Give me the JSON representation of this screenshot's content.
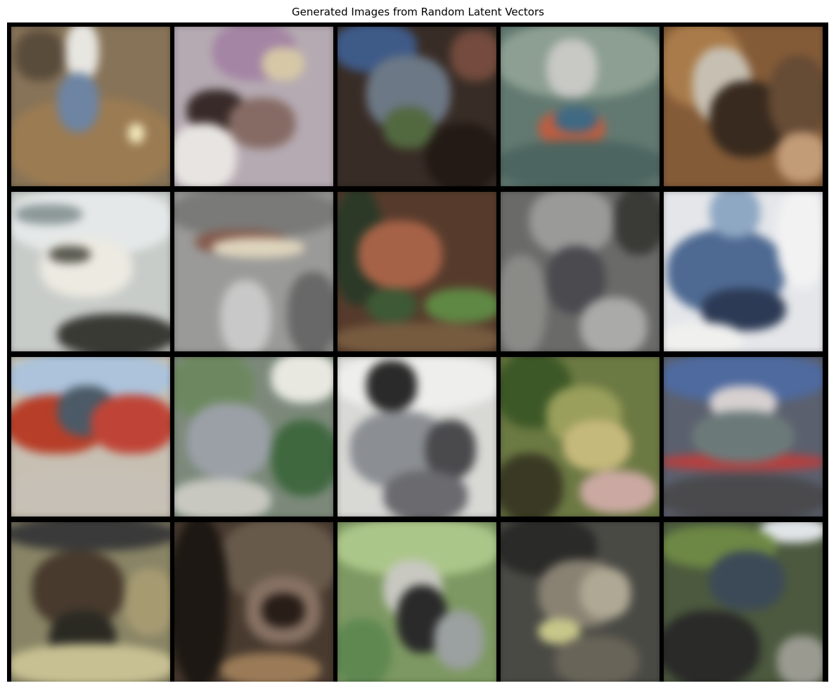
{
  "figure": {
    "title": "Generated Images from Random Latent Vectors"
  },
  "images": [
    {
      "id": "sample-1",
      "base": "#8a7352",
      "blobs": [
        [
          "#a07a4a",
          0.0,
          0.45,
          1.0,
          0.55
        ],
        [
          "#e8e6e0",
          0.35,
          0.0,
          0.2,
          0.35
        ],
        [
          "#6a84a8",
          0.3,
          0.3,
          0.25,
          0.35
        ],
        [
          "#f3e7b0",
          0.72,
          0.6,
          0.1,
          0.12
        ],
        [
          "#5c4c38",
          0.05,
          0.05,
          0.3,
          0.3
        ]
      ]
    },
    {
      "id": "sample-2",
      "base": "#b7a9b3",
      "blobs": [
        [
          "#a884a8",
          0.25,
          0.0,
          0.5,
          0.35
        ],
        [
          "#3a2a28",
          0.1,
          0.4,
          0.35,
          0.25
        ],
        [
          "#8a6a62",
          0.35,
          0.45,
          0.4,
          0.3
        ],
        [
          "#e8e4e0",
          0.0,
          0.6,
          0.4,
          0.4
        ],
        [
          "#d8c8a0",
          0.55,
          0.15,
          0.25,
          0.2
        ]
      ]
    },
    {
      "id": "sample-3",
      "base": "#3a2c24",
      "blobs": [
        [
          "#3a5a90",
          0.0,
          0.0,
          0.5,
          0.3
        ],
        [
          "#6a7888",
          0.2,
          0.2,
          0.5,
          0.45
        ],
        [
          "#4f6a3a",
          0.3,
          0.5,
          0.3,
          0.25
        ],
        [
          "#241a14",
          0.55,
          0.6,
          0.45,
          0.4
        ],
        [
          "#7a4a3a",
          0.7,
          0.05,
          0.3,
          0.3
        ]
      ]
    },
    {
      "id": "sample-4",
      "base": "#5e7a70",
      "blobs": [
        [
          "#8aa090",
          0.0,
          0.0,
          1.0,
          0.45
        ],
        [
          "#c8c8c4",
          0.3,
          0.1,
          0.3,
          0.35
        ],
        [
          "#c85a3a",
          0.25,
          0.52,
          0.4,
          0.22
        ],
        [
          "#3a6a8a",
          0.35,
          0.5,
          0.25,
          0.15
        ],
        [
          "#4a6660",
          0.0,
          0.7,
          1.0,
          0.3
        ]
      ]
    },
    {
      "id": "sample-5",
      "base": "#8a5a30",
      "blobs": [
        [
          "#b07a40",
          0.0,
          0.0,
          0.5,
          0.5
        ],
        [
          "#c8c0b0",
          0.2,
          0.15,
          0.35,
          0.45
        ],
        [
          "#3a2a1c",
          0.3,
          0.35,
          0.45,
          0.45
        ],
        [
          "#6a4a30",
          0.65,
          0.2,
          0.35,
          0.5
        ],
        [
          "#c89a70",
          0.7,
          0.65,
          0.3,
          0.3
        ]
      ]
    },
    {
      "id": "sample-6",
      "base": "#c8ccc8",
      "blobs": [
        [
          "#e4e8e8",
          0.0,
          0.0,
          1.0,
          0.4
        ],
        [
          "#8a9898",
          0.05,
          0.1,
          0.4,
          0.12
        ],
        [
          "#eceae0",
          0.2,
          0.3,
          0.55,
          0.35
        ],
        [
          "#5a5a50",
          0.25,
          0.35,
          0.25,
          0.1
        ],
        [
          "#3a3a34",
          0.3,
          0.75,
          0.7,
          0.25
        ]
      ]
    },
    {
      "id": "sample-7",
      "base": "#9a9a98",
      "blobs": [
        [
          "#7a7a78",
          0.0,
          0.0,
          1.0,
          0.3
        ],
        [
          "#8a5a4a",
          0.15,
          0.25,
          0.55,
          0.15
        ],
        [
          "#e0d4b8",
          0.25,
          0.3,
          0.55,
          0.12
        ],
        [
          "#c8c8c8",
          0.3,
          0.55,
          0.3,
          0.45
        ],
        [
          "#686868",
          0.7,
          0.5,
          0.3,
          0.5
        ]
      ]
    },
    {
      "id": "sample-8",
      "base": "#5a3a28",
      "blobs": [
        [
          "#2a3a24",
          0.0,
          0.0,
          0.3,
          0.7
        ],
        [
          "#b06040",
          0.15,
          0.2,
          0.5,
          0.4
        ],
        [
          "#3a5a30",
          0.2,
          0.6,
          0.3,
          0.2
        ],
        [
          "#5a8a3a",
          0.55,
          0.6,
          0.45,
          0.2
        ],
        [
          "#7a5a3a",
          0.0,
          0.8,
          1.0,
          0.2
        ]
      ]
    },
    {
      "id": "sample-9",
      "base": "#6a6a68",
      "blobs": [
        [
          "#9a9a98",
          0.2,
          0.0,
          0.5,
          0.4
        ],
        [
          "#4a4a50",
          0.3,
          0.35,
          0.35,
          0.4
        ],
        [
          "#8a8a86",
          0.0,
          0.4,
          0.3,
          0.6
        ],
        [
          "#aaaaa8",
          0.5,
          0.65,
          0.4,
          0.35
        ],
        [
          "#3a3a36",
          0.7,
          0.0,
          0.3,
          0.4
        ]
      ]
    },
    {
      "id": "sample-10",
      "base": "#e4e6ea",
      "blobs": [
        [
          "#4a6a9a",
          0.05,
          0.25,
          0.7,
          0.5
        ],
        [
          "#2a3a5a",
          0.25,
          0.6,
          0.5,
          0.25
        ],
        [
          "#8aa8c8",
          0.3,
          0.0,
          0.3,
          0.3
        ],
        [
          "#f2f2f2",
          0.7,
          0.0,
          0.3,
          0.6
        ],
        [
          "#f0f0ee",
          0.0,
          0.8,
          0.5,
          0.2
        ]
      ]
    },
    {
      "id": "sample-11",
      "base": "#c8c0b0",
      "blobs": [
        [
          "#a8c4e0",
          0.0,
          0.0,
          1.0,
          0.3
        ],
        [
          "#c83a20",
          0.0,
          0.25,
          0.6,
          0.35
        ],
        [
          "#4a5a6a",
          0.3,
          0.2,
          0.35,
          0.3
        ],
        [
          "#d04030",
          0.5,
          0.25,
          0.5,
          0.35
        ],
        [
          "#c8c0b4",
          0.0,
          0.7,
          1.0,
          0.3
        ]
      ]
    },
    {
      "id": "sample-12",
      "base": "#7a8a78",
      "blobs": [
        [
          "#e8e8e0",
          0.6,
          0.0,
          0.4,
          0.3
        ],
        [
          "#6a8a5a",
          0.0,
          0.0,
          0.5,
          0.4
        ],
        [
          "#9aa0a8",
          0.1,
          0.3,
          0.5,
          0.45
        ],
        [
          "#3a6a3a",
          0.6,
          0.4,
          0.4,
          0.45
        ],
        [
          "#c8c8c0",
          0.0,
          0.75,
          0.6,
          0.25
        ]
      ]
    },
    {
      "id": "sample-13",
      "base": "#d8d8d4",
      "blobs": [
        [
          "#eeeeec",
          0.0,
          0.0,
          1.0,
          0.35
        ],
        [
          "#2a2a2a",
          0.2,
          0.05,
          0.3,
          0.3
        ],
        [
          "#8a8e94",
          0.1,
          0.35,
          0.6,
          0.45
        ],
        [
          "#4a4a4e",
          0.55,
          0.4,
          0.3,
          0.35
        ],
        [
          "#6a6a70",
          0.3,
          0.7,
          0.5,
          0.3
        ]
      ]
    },
    {
      "id": "sample-14",
      "base": "#6a7a3a",
      "blobs": [
        [
          "#3a5a20",
          0.0,
          0.0,
          0.45,
          0.45
        ],
        [
          "#9aa050",
          0.3,
          0.2,
          0.45,
          0.35
        ],
        [
          "#c8b870",
          0.4,
          0.4,
          0.4,
          0.3
        ],
        [
          "#d0a8a0",
          0.5,
          0.7,
          0.45,
          0.25
        ],
        [
          "#3a3a20",
          0.0,
          0.6,
          0.4,
          0.4
        ]
      ]
    },
    {
      "id": "sample-15",
      "base": "#5a6070",
      "blobs": [
        [
          "#4a6aa8",
          0.0,
          0.0,
          1.0,
          0.3
        ],
        [
          "#d8d0d0",
          0.3,
          0.2,
          0.4,
          0.2
        ],
        [
          "#c83a3a",
          0.0,
          0.6,
          1.0,
          0.1
        ],
        [
          "#6a7a7a",
          0.2,
          0.35,
          0.6,
          0.3
        ],
        [
          "#4a4a4e",
          0.0,
          0.72,
          1.0,
          0.28
        ]
      ]
    },
    {
      "id": "sample-16",
      "base": "#8a8460",
      "blobs": [
        [
          "#3a3a3a",
          0.0,
          0.0,
          1.0,
          0.2
        ],
        [
          "#4a3a2a",
          0.15,
          0.2,
          0.55,
          0.45
        ],
        [
          "#2a2a22",
          0.25,
          0.55,
          0.4,
          0.35
        ],
        [
          "#c8c08a",
          0.0,
          0.75,
          1.0,
          0.25
        ],
        [
          "#a89a6a",
          0.7,
          0.3,
          0.3,
          0.4
        ]
      ]
    },
    {
      "id": "sample-17",
      "base": "#4a3a2c",
      "blobs": [
        [
          "#6a5a48",
          0.3,
          0.0,
          0.7,
          0.5
        ],
        [
          "#1e1812",
          0.0,
          0.0,
          0.35,
          1.0
        ],
        [
          "#8a7060",
          0.45,
          0.35,
          0.45,
          0.4
        ],
        [
          "#2a1e16",
          0.55,
          0.45,
          0.25,
          0.2
        ],
        [
          "#a07a50",
          0.3,
          0.8,
          0.6,
          0.2
        ]
      ]
    },
    {
      "id": "sample-18",
      "base": "#7a9a5a",
      "blobs": [
        [
          "#a8c880",
          0.0,
          0.0,
          1.0,
          0.35
        ],
        [
          "#c8c8c0",
          0.3,
          0.25,
          0.35,
          0.35
        ],
        [
          "#2a2a2a",
          0.38,
          0.4,
          0.3,
          0.4
        ],
        [
          "#5a8a4a",
          0.0,
          0.6,
          0.35,
          0.4
        ],
        [
          "#9aa0a0",
          0.6,
          0.55,
          0.3,
          0.35
        ]
      ]
    },
    {
      "id": "sample-19",
      "base": "#4a4a44",
      "blobs": [
        [
          "#2a2a28",
          0.0,
          0.0,
          0.6,
          0.35
        ],
        [
          "#8a8270",
          0.25,
          0.25,
          0.5,
          0.4
        ],
        [
          "#b0a890",
          0.5,
          0.3,
          0.3,
          0.3
        ],
        [
          "#c8c880",
          0.25,
          0.6,
          0.25,
          0.15
        ],
        [
          "#6a6456",
          0.35,
          0.7,
          0.5,
          0.3
        ]
      ]
    },
    {
      "id": "sample-20",
      "base": "#4a5a3a",
      "blobs": [
        [
          "#e0e4e8",
          0.6,
          0.0,
          0.4,
          0.15
        ],
        [
          "#6a8a3a",
          0.0,
          0.05,
          0.7,
          0.25
        ],
        [
          "#3a4a5a",
          0.3,
          0.2,
          0.45,
          0.35
        ],
        [
          "#2a2a28",
          0.0,
          0.55,
          0.6,
          0.45
        ],
        [
          "#9a9a90",
          0.7,
          0.7,
          0.3,
          0.3
        ]
      ]
    }
  ]
}
